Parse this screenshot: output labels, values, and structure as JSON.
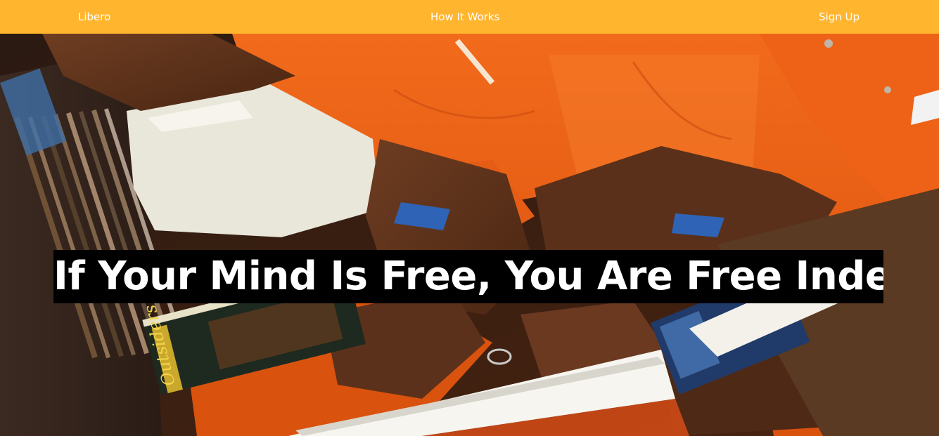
{
  "navbar": {
    "brand": "Libero",
    "how_it_works": "How It Works",
    "sign_up": "Sign Up",
    "background": "#ffb52e"
  },
  "hero": {
    "headline": "If Your Mind Is Free, You Are Free Indeed",
    "image": "photo of people in orange jumpsuits reading books",
    "accent_color": "#e8601a",
    "book_cover_title": "The Outsiders"
  }
}
